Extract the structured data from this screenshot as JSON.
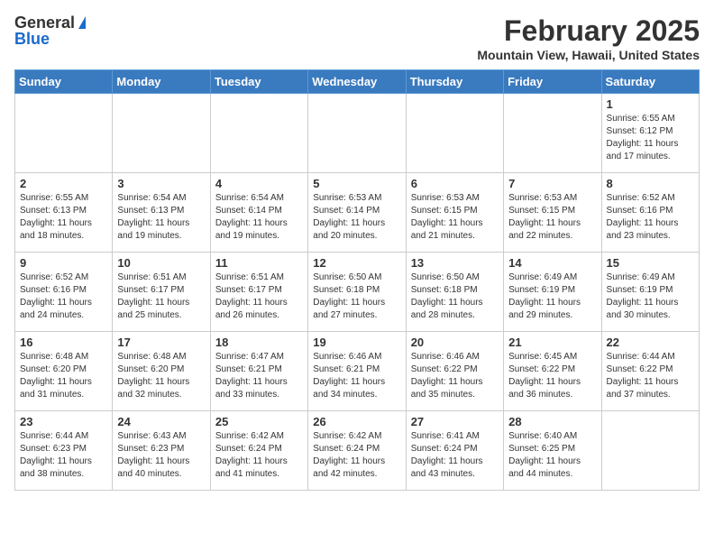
{
  "header": {
    "logo_general": "General",
    "logo_blue": "Blue",
    "month_title": "February 2025",
    "location": "Mountain View, Hawaii, United States"
  },
  "weekdays": [
    "Sunday",
    "Monday",
    "Tuesday",
    "Wednesday",
    "Thursday",
    "Friday",
    "Saturday"
  ],
  "weeks": [
    [
      {
        "day": "",
        "info": ""
      },
      {
        "day": "",
        "info": ""
      },
      {
        "day": "",
        "info": ""
      },
      {
        "day": "",
        "info": ""
      },
      {
        "day": "",
        "info": ""
      },
      {
        "day": "",
        "info": ""
      },
      {
        "day": "1",
        "info": "Sunrise: 6:55 AM\nSunset: 6:12 PM\nDaylight: 11 hours\nand 17 minutes."
      }
    ],
    [
      {
        "day": "2",
        "info": "Sunrise: 6:55 AM\nSunset: 6:13 PM\nDaylight: 11 hours\nand 18 minutes."
      },
      {
        "day": "3",
        "info": "Sunrise: 6:54 AM\nSunset: 6:13 PM\nDaylight: 11 hours\nand 19 minutes."
      },
      {
        "day": "4",
        "info": "Sunrise: 6:54 AM\nSunset: 6:14 PM\nDaylight: 11 hours\nand 19 minutes."
      },
      {
        "day": "5",
        "info": "Sunrise: 6:53 AM\nSunset: 6:14 PM\nDaylight: 11 hours\nand 20 minutes."
      },
      {
        "day": "6",
        "info": "Sunrise: 6:53 AM\nSunset: 6:15 PM\nDaylight: 11 hours\nand 21 minutes."
      },
      {
        "day": "7",
        "info": "Sunrise: 6:53 AM\nSunset: 6:15 PM\nDaylight: 11 hours\nand 22 minutes."
      },
      {
        "day": "8",
        "info": "Sunrise: 6:52 AM\nSunset: 6:16 PM\nDaylight: 11 hours\nand 23 minutes."
      }
    ],
    [
      {
        "day": "9",
        "info": "Sunrise: 6:52 AM\nSunset: 6:16 PM\nDaylight: 11 hours\nand 24 minutes."
      },
      {
        "day": "10",
        "info": "Sunrise: 6:51 AM\nSunset: 6:17 PM\nDaylight: 11 hours\nand 25 minutes."
      },
      {
        "day": "11",
        "info": "Sunrise: 6:51 AM\nSunset: 6:17 PM\nDaylight: 11 hours\nand 26 minutes."
      },
      {
        "day": "12",
        "info": "Sunrise: 6:50 AM\nSunset: 6:18 PM\nDaylight: 11 hours\nand 27 minutes."
      },
      {
        "day": "13",
        "info": "Sunrise: 6:50 AM\nSunset: 6:18 PM\nDaylight: 11 hours\nand 28 minutes."
      },
      {
        "day": "14",
        "info": "Sunrise: 6:49 AM\nSunset: 6:19 PM\nDaylight: 11 hours\nand 29 minutes."
      },
      {
        "day": "15",
        "info": "Sunrise: 6:49 AM\nSunset: 6:19 PM\nDaylight: 11 hours\nand 30 minutes."
      }
    ],
    [
      {
        "day": "16",
        "info": "Sunrise: 6:48 AM\nSunset: 6:20 PM\nDaylight: 11 hours\nand 31 minutes."
      },
      {
        "day": "17",
        "info": "Sunrise: 6:48 AM\nSunset: 6:20 PM\nDaylight: 11 hours\nand 32 minutes."
      },
      {
        "day": "18",
        "info": "Sunrise: 6:47 AM\nSunset: 6:21 PM\nDaylight: 11 hours\nand 33 minutes."
      },
      {
        "day": "19",
        "info": "Sunrise: 6:46 AM\nSunset: 6:21 PM\nDaylight: 11 hours\nand 34 minutes."
      },
      {
        "day": "20",
        "info": "Sunrise: 6:46 AM\nSunset: 6:22 PM\nDaylight: 11 hours\nand 35 minutes."
      },
      {
        "day": "21",
        "info": "Sunrise: 6:45 AM\nSunset: 6:22 PM\nDaylight: 11 hours\nand 36 minutes."
      },
      {
        "day": "22",
        "info": "Sunrise: 6:44 AM\nSunset: 6:22 PM\nDaylight: 11 hours\nand 37 minutes."
      }
    ],
    [
      {
        "day": "23",
        "info": "Sunrise: 6:44 AM\nSunset: 6:23 PM\nDaylight: 11 hours\nand 38 minutes."
      },
      {
        "day": "24",
        "info": "Sunrise: 6:43 AM\nSunset: 6:23 PM\nDaylight: 11 hours\nand 40 minutes."
      },
      {
        "day": "25",
        "info": "Sunrise: 6:42 AM\nSunset: 6:24 PM\nDaylight: 11 hours\nand 41 minutes."
      },
      {
        "day": "26",
        "info": "Sunrise: 6:42 AM\nSunset: 6:24 PM\nDaylight: 11 hours\nand 42 minutes."
      },
      {
        "day": "27",
        "info": "Sunrise: 6:41 AM\nSunset: 6:24 PM\nDaylight: 11 hours\nand 43 minutes."
      },
      {
        "day": "28",
        "info": "Sunrise: 6:40 AM\nSunset: 6:25 PM\nDaylight: 11 hours\nand 44 minutes."
      },
      {
        "day": "",
        "info": ""
      }
    ]
  ]
}
